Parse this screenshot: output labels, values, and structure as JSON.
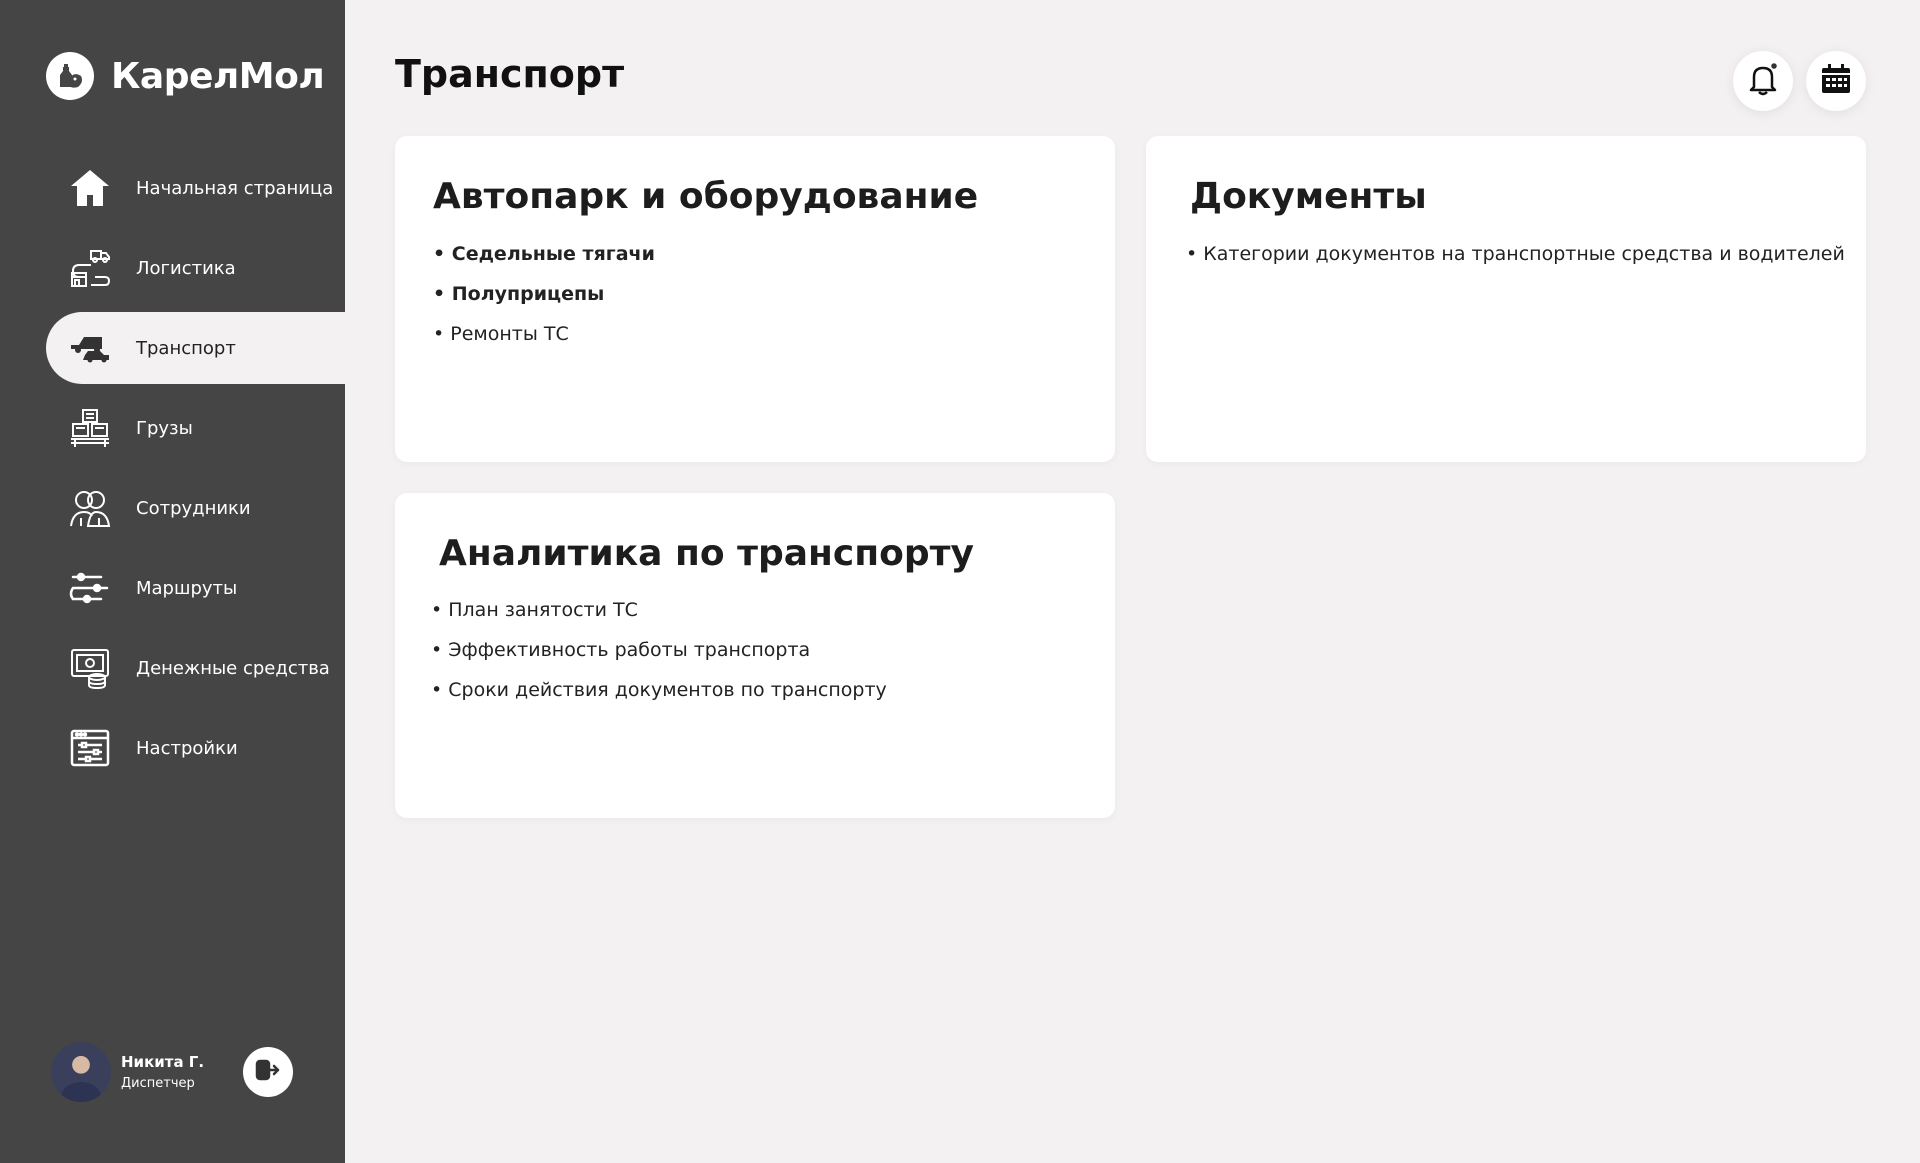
{
  "app": {
    "brand_name": "КарелМол",
    "brand_icon": "milk-logo-icon"
  },
  "sidebar": {
    "items": [
      {
        "label": "Начальная страница",
        "icon": "home-icon",
        "active": false
      },
      {
        "label": "Логистика",
        "icon": "logistics-icon",
        "active": false
      },
      {
        "label": "Транспорт",
        "icon": "transport-icon",
        "active": true
      },
      {
        "label": "Грузы",
        "icon": "cargo-icon",
        "active": false
      },
      {
        "label": "Сотрудники",
        "icon": "employees-icon",
        "active": false
      },
      {
        "label": "Маршруты",
        "icon": "routes-icon",
        "active": false
      },
      {
        "label": "Денежные средства",
        "icon": "money-icon",
        "active": false
      },
      {
        "label": "Настройки",
        "icon": "settings-icon",
        "active": false
      }
    ]
  },
  "user": {
    "name": "Никита Г.",
    "role": "Диспетчер"
  },
  "header": {
    "title": "Транспорт",
    "notification_icon": "bell-icon",
    "calendar_icon": "calendar-icon",
    "has_unread": true
  },
  "cards": {
    "fleet": {
      "title": "Автопарк и оборудование",
      "items": [
        "• Седельные тягачи",
        "• Полуприцепы",
        "• Ремонты ТС"
      ]
    },
    "documents": {
      "title": "Документы",
      "items": [
        "• Категории документов на транспортные средства и водителей"
      ]
    },
    "analytics": {
      "title": "Аналитика по транспорту",
      "items": [
        "• План занятости ТС",
        "• Эффективность работы транспорта",
        "• Сроки действия документов по транспорту"
      ]
    }
  },
  "colors": {
    "sidebar_bg": "#454545",
    "page_bg": "#f4f1f2",
    "card_bg": "#ffffff"
  }
}
